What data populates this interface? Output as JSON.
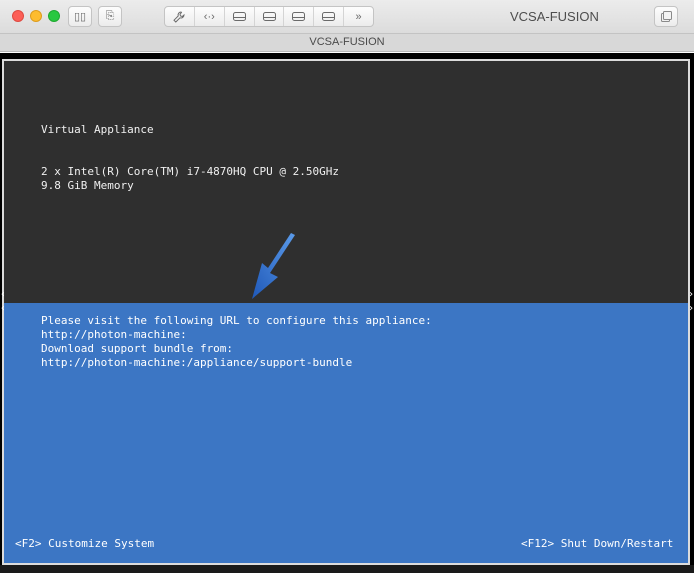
{
  "window": {
    "title": "VCSA-FUSION",
    "tab_title": "VCSA-FUSION"
  },
  "toolbar": {
    "icons": [
      "sidebar-toggle-icon",
      "snapshot-icon",
      "settings-wrench-icon",
      "connect-network-icon",
      "disk-icon",
      "disk-icon",
      "disk-icon",
      "disk-icon",
      "more-chevrons-icon",
      "fullscreen-icon"
    ],
    "glyphs": {
      "sidebar": "▯▯",
      "snapshot": "⎘",
      "wrench": "🔧",
      "network": "‹·›",
      "disk": "▭",
      "more": "»",
      "fullscreen": "⧉"
    }
  },
  "console": {
    "upper": {
      "title": "Virtual Appliance",
      "cpu": "2 x Intel(R) Core(TM) i7-4870HQ CPU @ 2.50GHz",
      "memory": "9.8 GiB Memory"
    },
    "lower": {
      "line1": "Please visit the following URL to configure this appliance:",
      "line2": "http://photon-machine:",
      "line3": "Download support bundle from:",
      "line4": "http://photon-machine:/appliance/support-bundle",
      "f2": "<F2> Customize System",
      "f12": "<F12> Shut Down/Restart"
    }
  },
  "colors": {
    "upper_bg": "#2f2f2f",
    "lower_bg": "#3c76c4",
    "arrow": "#2a64c8"
  }
}
